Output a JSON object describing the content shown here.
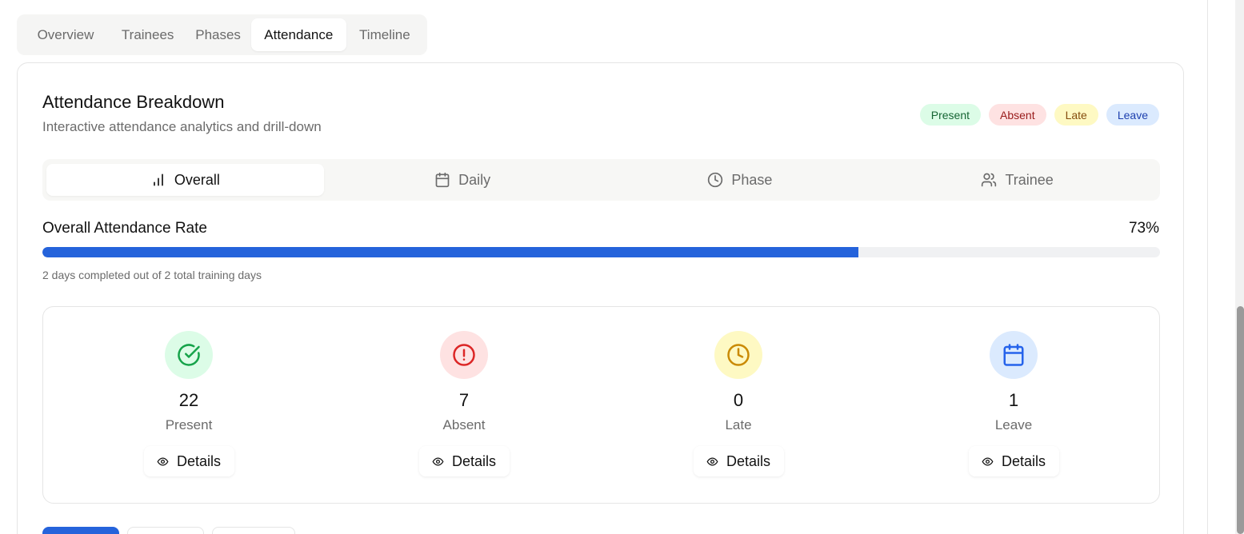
{
  "tabs": [
    "Overview",
    "Trainees",
    "Phases",
    "Attendance",
    "Timeline"
  ],
  "active_tab": "Attendance",
  "card": {
    "title": "Attendance Breakdown",
    "subtitle": "Interactive attendance analytics and drill-down",
    "badges": {
      "present": "Present",
      "absent": "Absent",
      "late": "Late",
      "leave": "Leave"
    }
  },
  "subtabs": {
    "overall": "Overall",
    "daily": "Daily",
    "phase": "Phase",
    "trainee": "Trainee"
  },
  "rate": {
    "label": "Overall Attendance Rate",
    "value": "73%",
    "fraction": 0.73,
    "note": "2 days completed out of 2 total training days"
  },
  "stats": {
    "present": {
      "count": "22",
      "label": "Present"
    },
    "absent": {
      "count": "7",
      "label": "Absent"
    },
    "late": {
      "count": "0",
      "label": "Late"
    },
    "leave": {
      "count": "1",
      "label": "Leave"
    }
  },
  "details_label": "Details",
  "colors": {
    "accent": "#2563db",
    "present": "#16a34a",
    "absent": "#dc2626",
    "late": "#ca8a04",
    "leave": "#2563eb"
  }
}
